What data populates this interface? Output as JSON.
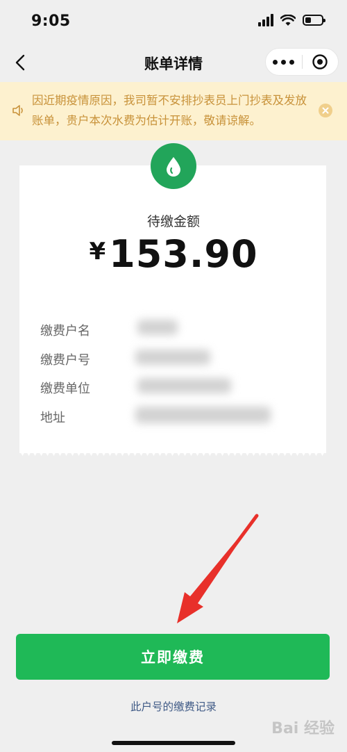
{
  "status_bar": {
    "time": "9:05"
  },
  "nav": {
    "title": "账单详情"
  },
  "notice": {
    "text": "因近期疫情原因，我司暂不安排抄表员上门抄表及发放账单，贵户本次水费为估计开账，敬请谅解。",
    "color": "#c8923a",
    "background": "#fdf1cf"
  },
  "bill": {
    "amount_label": "待缴金额",
    "currency": "¥",
    "amount": "153.90",
    "fields": [
      {
        "label": "缴费户名"
      },
      {
        "label": "缴费户号"
      },
      {
        "label": "缴费单位"
      },
      {
        "label": "地址"
      }
    ],
    "badge_color": "#22a55a"
  },
  "actions": {
    "pay_label": "立即缴费",
    "pay_color": "#1fb957",
    "records_label": "此户号的缴费记录"
  },
  "watermark": "Bai 经验"
}
